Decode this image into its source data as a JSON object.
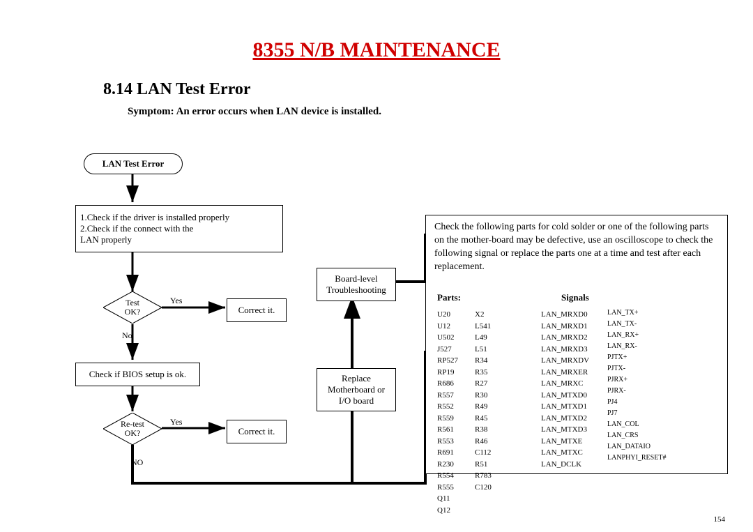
{
  "title": "8355 N/B MAINTENANCE",
  "subtitle": "8.14 LAN Test Error",
  "symptom": "Symptom: An error occurs when  LAN device is installed.",
  "terminator": "LAN Test Error",
  "step1": "1.Check if the driver is installed properly\n2.Check if the connect with the\n    LAN properly",
  "testok": "Test\nOK?",
  "yes1": "Yes",
  "no1": "No",
  "correct1": "Correct it.",
  "bios": "Check if BIOS setup is ok.",
  "retest": "Re-test\nOK?",
  "yes2": "Yes",
  "no2": "NO",
  "correct2": "Correct it.",
  "boardlevel": "Board-level\nTroubleshooting",
  "replace": "Replace\nMotherboard or\nI/O board",
  "intro": "Check the following parts for cold solder or one of the following parts on the mother-board may be defective, use an oscilloscope to check the following signal or replace the parts one at a time and test after each replacement.",
  "partsHdr": "Parts:",
  "signalsHdr": "Signals",
  "partsCol1": [
    "U20",
    "U12",
    "U502",
    "J527",
    "RP527",
    "RP19",
    "R686",
    "R557",
    "R552",
    "R559",
    "R561",
    "R553",
    "R691",
    "R230",
    "R554",
    "R555",
    "Q11",
    "Q12"
  ],
  "partsCol2": [
    "X2",
    "L541",
    "L49",
    "L51",
    "R34",
    "R35",
    "R27",
    "R30",
    "R49",
    "R45",
    "R38",
    "R46",
    "C112",
    "R51",
    "R783",
    "C120"
  ],
  "sigCol1": [
    "LAN_MRXD0",
    "LAN_MRXD1",
    "LAN_MRXD2",
    "LAN_MRXD3",
    "LAN_MRXDV",
    "LAN_MRXER",
    "LAN_MRXC",
    "LAN_MTXD0",
    "LAN_MTXD1",
    "LAN_MTXD2",
    "LAN_MTXD3",
    "LAN_MTXE",
    "LAN_MTXC",
    "LAN_DCLK"
  ],
  "sigCol2": [
    "LAN_TX+",
    "LAN_TX-",
    "LAN_RX+",
    "LAN_RX-",
    "PJTX+",
    "PJTX-",
    "PJRX+",
    "PJRX-",
    "PJ4",
    "PJ7",
    "LAN_COL",
    "LAN_CRS",
    "LAN_DATAIO",
    "LANPHYI_RESET#"
  ],
  "pagenum": "154"
}
